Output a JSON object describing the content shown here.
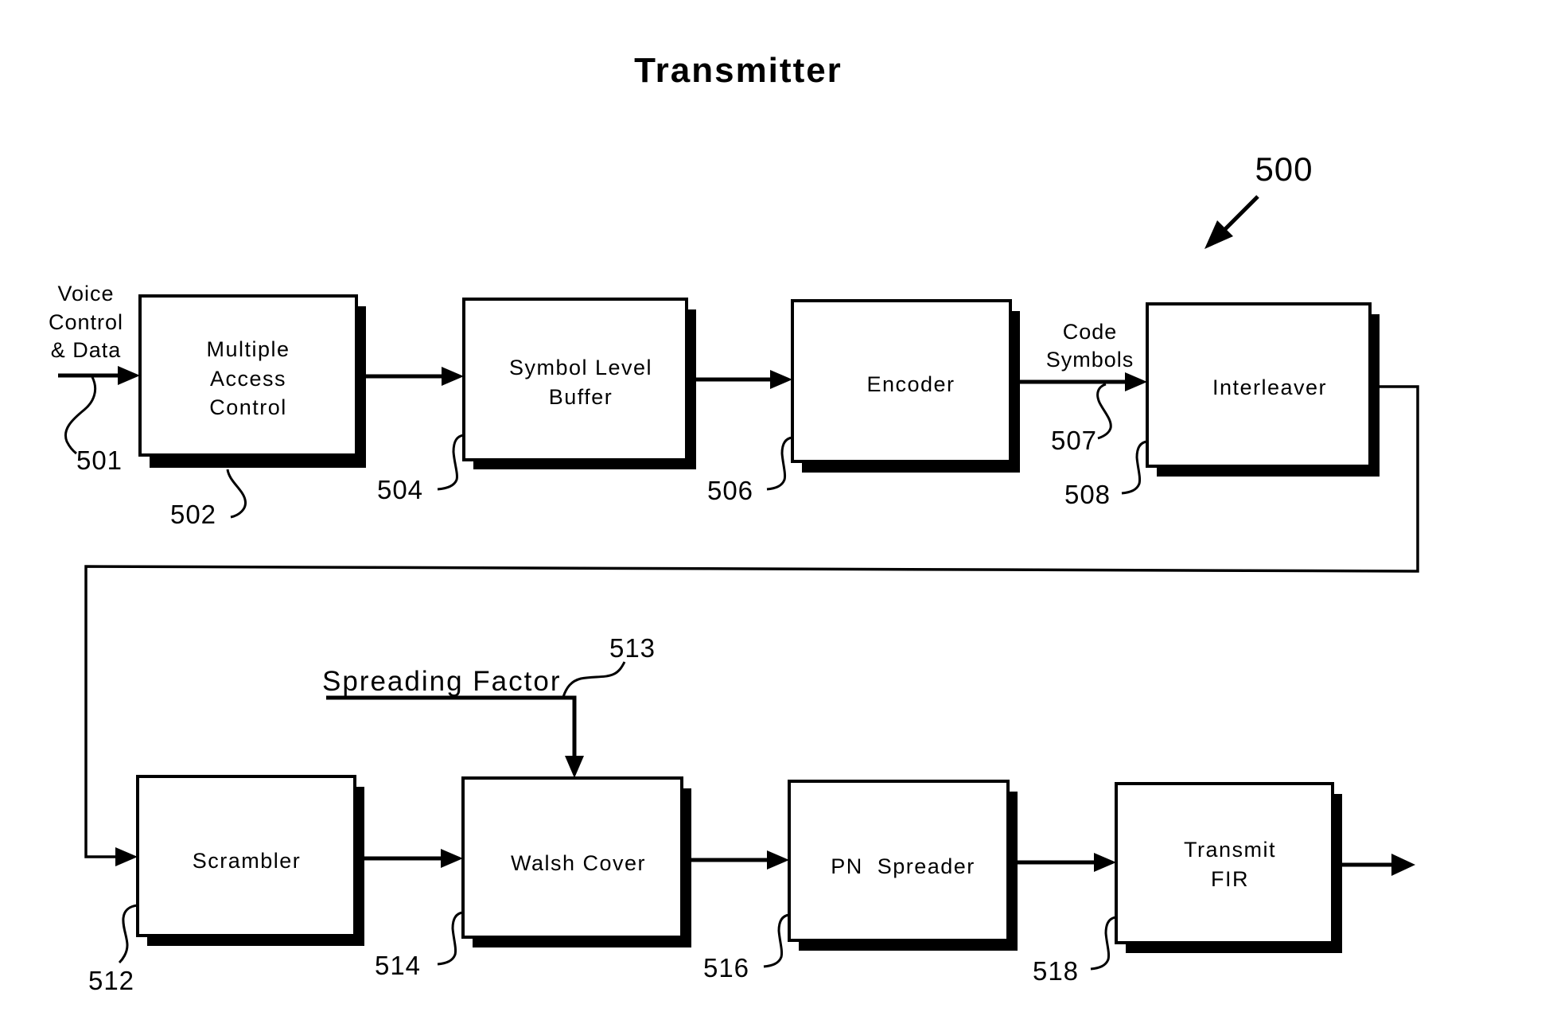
{
  "title": "Transmitter",
  "figure_ref": "500",
  "input": {
    "label_lines": [
      "Voice",
      "Control",
      "& Data"
    ],
    "ref": "501"
  },
  "row1": [
    {
      "id": "mac",
      "label_lines": [
        "Multiple",
        "Access",
        "Control"
      ],
      "ref": "502"
    },
    {
      "id": "slb",
      "label_lines": [
        "Symbol Level",
        "Buffer"
      ],
      "ref": "504"
    },
    {
      "id": "encoder",
      "label_lines": [
        "Encoder"
      ],
      "ref": "506"
    },
    {
      "id": "interleaver",
      "label_lines": [
        "Interleaver"
      ],
      "ref": "508"
    }
  ],
  "code_symbols": {
    "label_lines": [
      "Code",
      "Symbols"
    ],
    "ref": "507"
  },
  "spreading_factor": {
    "label": "Spreading Factor",
    "ref": "513"
  },
  "row2": [
    {
      "id": "scrambler",
      "label_lines": [
        "Scrambler"
      ],
      "ref": "512"
    },
    {
      "id": "walsh",
      "label_lines": [
        "Walsh Cover"
      ],
      "ref": "514"
    },
    {
      "id": "pn",
      "label_lines": [
        "PN  Spreader"
      ],
      "ref": "516"
    },
    {
      "id": "fir",
      "label_lines": [
        "Transmit",
        "FIR"
      ],
      "ref": "518"
    }
  ]
}
